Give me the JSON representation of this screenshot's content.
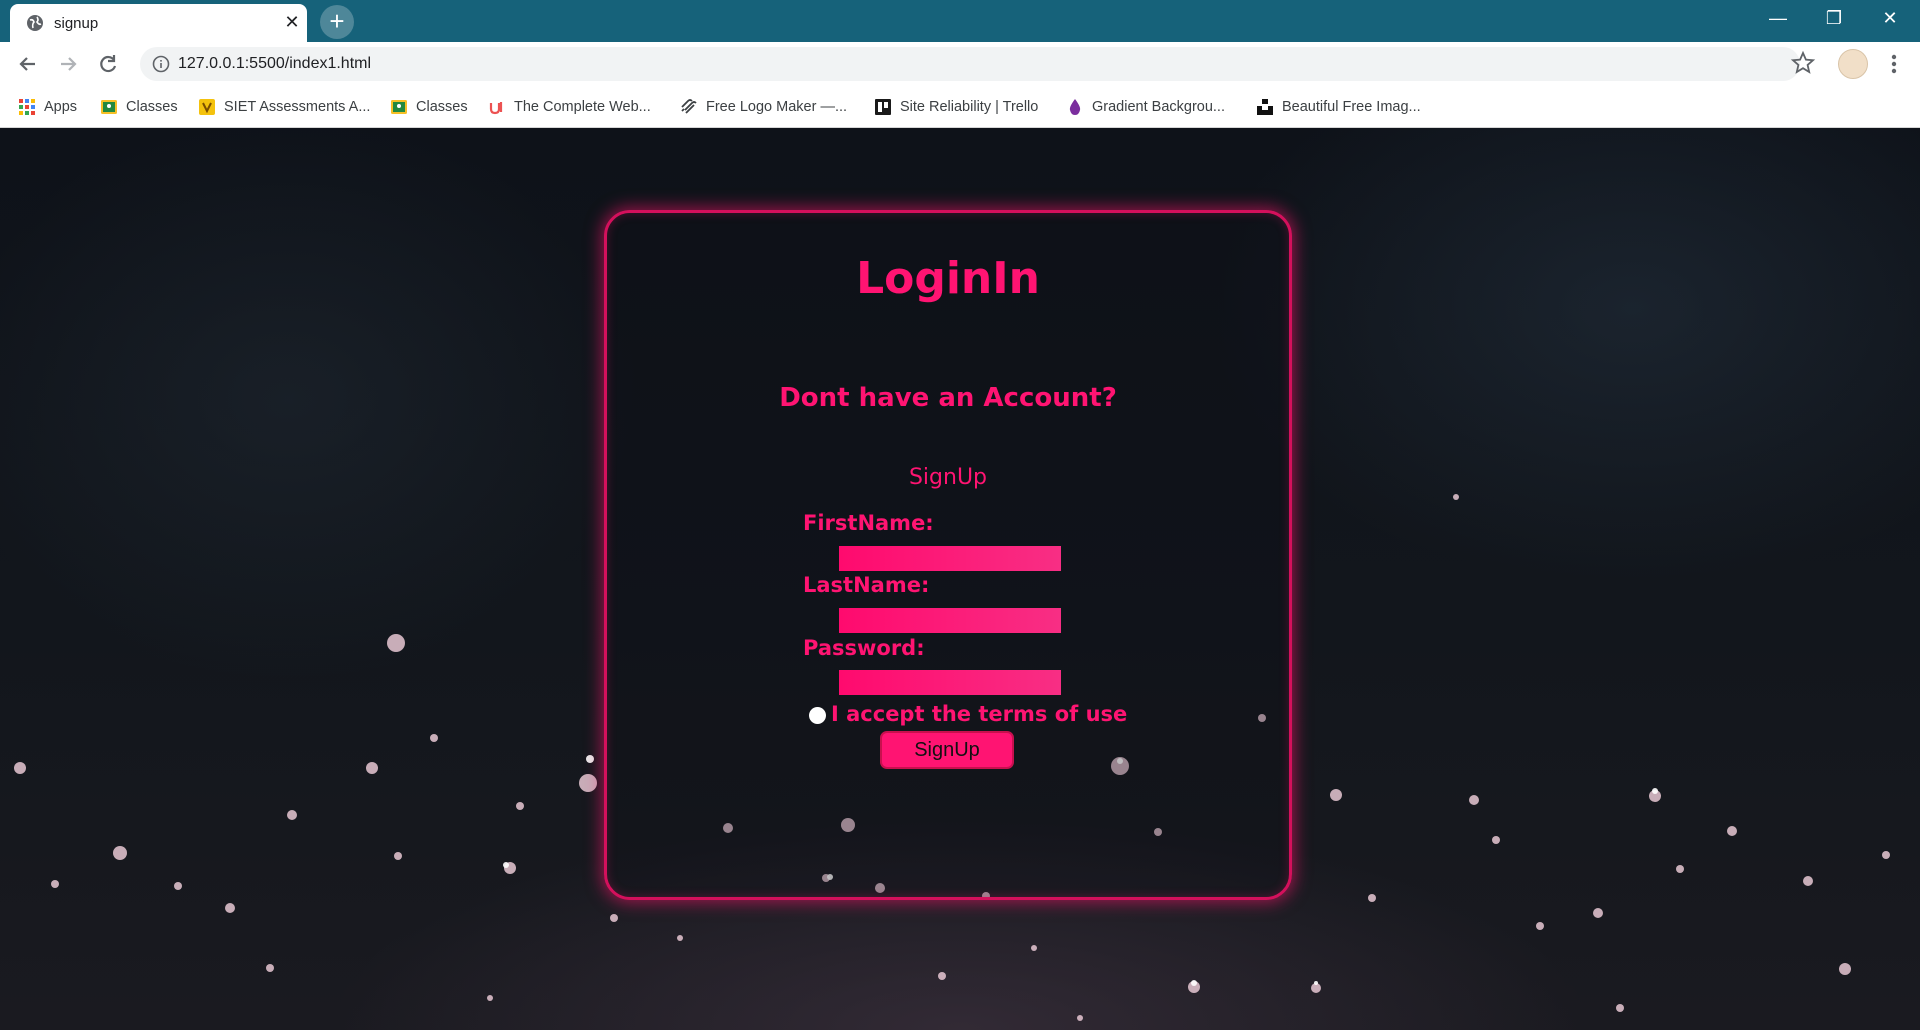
{
  "browser": {
    "tab_title": "signup",
    "url": "127.0.0.1:5500/index1.html",
    "bookmarks": [
      {
        "label": "Apps",
        "icon": "apps-grid-icon"
      },
      {
        "label": "Classes",
        "icon": "google-classroom-icon"
      },
      {
        "label": "SIET Assessments A...",
        "icon": "siet-icon"
      },
      {
        "label": "Classes",
        "icon": "google-classroom-icon"
      },
      {
        "label": "The Complete Web...",
        "icon": "udemy-icon"
      },
      {
        "label": "Free Logo Maker —...",
        "icon": "squarespace-icon"
      },
      {
        "label": "Site Reliability | Trello",
        "icon": "trello-icon"
      },
      {
        "label": "Gradient Backgrou...",
        "icon": "gradient-drop-icon"
      },
      {
        "label": "Beautiful Free Imag...",
        "icon": "unsplash-icon"
      }
    ]
  },
  "card": {
    "title": "LoginIn",
    "subtitle": "Dont have an Account?",
    "signup_link": "SignUp",
    "fields": [
      {
        "label": "FirstName:",
        "value": ""
      },
      {
        "label": "LastName:",
        "value": ""
      },
      {
        "label": "Password:",
        "value": ""
      }
    ],
    "terms_label": "I accept the terms of use",
    "submit_label": "SignUp"
  },
  "colors": {
    "accent": "#ff1472",
    "tabbar": "#16627a",
    "card_border": "#d4105c"
  }
}
